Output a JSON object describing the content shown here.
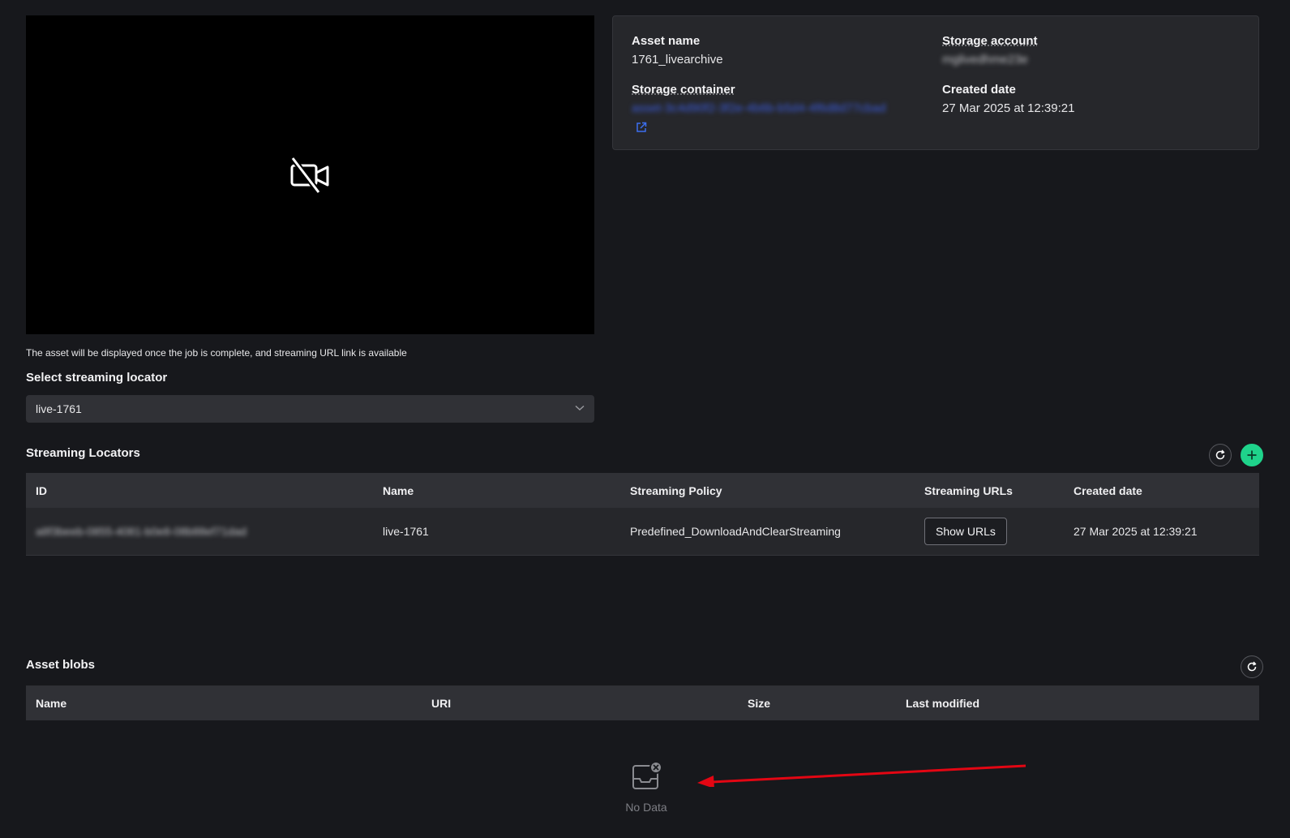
{
  "video": {
    "icon": "video-off-icon"
  },
  "asset_info": {
    "asset_name_label": "Asset name",
    "asset_name_value": "1761_livearchive",
    "storage_account_label": "Storage account",
    "storage_account_value": "mglivedhme23e",
    "storage_container_label": "Storage container",
    "storage_container_value": "asset-3c4d90f2-3f2e-4b6b-b5d4-4f6d8d77cbad",
    "created_date_label": "Created date",
    "created_date_value": "27 Mar 2025 at 12:39:21"
  },
  "notice": "The asset will be displayed once the job is complete, and streaming URL link is available",
  "locator_select": {
    "label": "Select streaming locator",
    "selected": "live-1761"
  },
  "streaming_locators": {
    "title": "Streaming Locators",
    "columns": [
      "ID",
      "Name",
      "Streaming Policy",
      "Streaming URLs",
      "Created date"
    ],
    "rows": [
      {
        "id": "a8f3beeb-0855-4081-b0e8-08b88ef71dad",
        "name": "live-1761",
        "policy": "Predefined_DownloadAndClearStreaming",
        "urls_button": "Show URLs",
        "created": "27 Mar 2025 at 12:39:21"
      }
    ]
  },
  "asset_blobs": {
    "title": "Asset blobs",
    "columns": [
      "Name",
      "URI",
      "Size",
      "Last modified"
    ],
    "empty_text": "No Data"
  },
  "colors": {
    "accent_green": "#1fd38b",
    "annotation_arrow": "#e30613",
    "link_blue": "#3b5bdb"
  }
}
